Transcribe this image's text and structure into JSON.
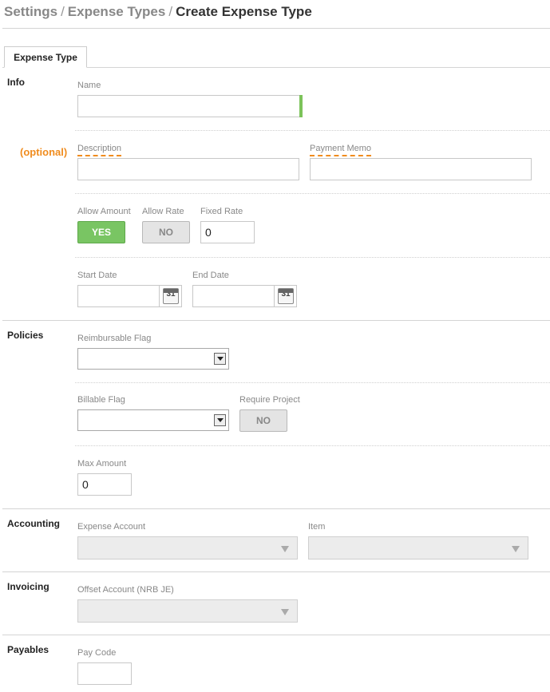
{
  "breadcrumb": {
    "items": [
      "Settings",
      "Expense Types"
    ],
    "current": "Create Expense Type",
    "separator": "/"
  },
  "tabs": [
    {
      "label": "Expense Type",
      "active": true
    }
  ],
  "sections": {
    "info": {
      "title": "Info",
      "name": {
        "label": "Name",
        "value": ""
      },
      "optional_tag": "(optional)",
      "description": {
        "label": "Description",
        "value": ""
      },
      "payment_memo": {
        "label": "Payment Memo",
        "value": ""
      },
      "allow_amount": {
        "label": "Allow Amount",
        "value": "YES"
      },
      "allow_rate": {
        "label": "Allow Rate",
        "value": "NO"
      },
      "fixed_rate": {
        "label": "Fixed Rate",
        "value": "0"
      },
      "start_date": {
        "label": "Start Date",
        "value": "",
        "icon": "calendar-icon",
        "icon_text": "31"
      },
      "end_date": {
        "label": "End Date",
        "value": "",
        "icon": "calendar-icon",
        "icon_text": "31"
      }
    },
    "policies": {
      "title": "Policies",
      "reimbursable_flag": {
        "label": "Reimbursable Flag",
        "value": ""
      },
      "billable_flag": {
        "label": "Billable Flag",
        "value": ""
      },
      "require_project": {
        "label": "Require Project",
        "value": "NO"
      },
      "max_amount": {
        "label": "Max Amount",
        "value": "0"
      }
    },
    "accounting": {
      "title": "Accounting",
      "expense_account": {
        "label": "Expense Account",
        "value": ""
      },
      "item": {
        "label": "Item",
        "value": ""
      }
    },
    "invoicing": {
      "title": "Invoicing",
      "offset_account": {
        "label": "Offset Account (NRB JE)",
        "value": ""
      }
    },
    "payables": {
      "title": "Payables",
      "pay_code": {
        "label": "Pay Code",
        "value": ""
      }
    }
  },
  "colors": {
    "accent_green": "#79c563",
    "required_marker": "#7cc35a",
    "optional_orange": "#f08c1e"
  }
}
